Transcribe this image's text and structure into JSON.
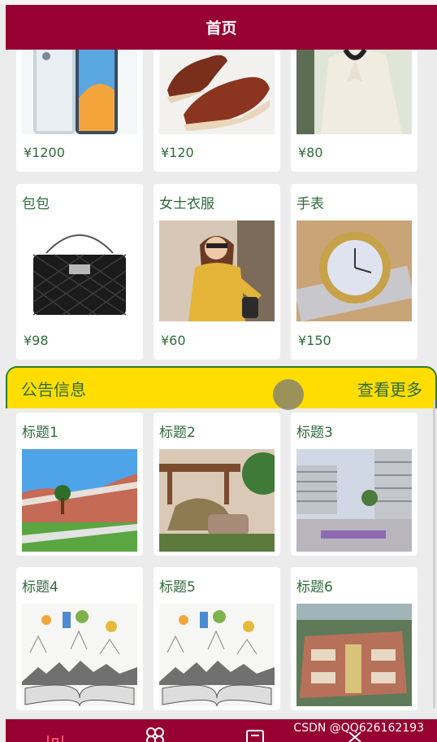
{
  "header": {
    "title": "首页"
  },
  "products_top": [
    {
      "price": "¥1200",
      "image_icon": "phone-image"
    },
    {
      "price": "¥120",
      "image_icon": "shoes-image"
    },
    {
      "price": "¥80",
      "image_icon": "blouse-image"
    }
  ],
  "products": [
    {
      "name": "包包",
      "price": "¥98",
      "image_icon": "handbag-image"
    },
    {
      "name": "女士衣服",
      "price": "¥60",
      "image_icon": "womens-clothing-image"
    },
    {
      "name": "手表",
      "price": "¥150",
      "image_icon": "watch-image"
    }
  ],
  "notice": {
    "title": "公告信息",
    "more": "查看更多"
  },
  "notices": [
    {
      "title": "标题1",
      "image_icon": "campus-garden-image"
    },
    {
      "title": "标题2",
      "image_icon": "sculpture-image"
    },
    {
      "title": "标题3",
      "image_icon": "campus-plaza-image"
    },
    {
      "title": "标题4",
      "image_icon": "book-city-image"
    },
    {
      "title": "标题5",
      "image_icon": "book-city-image"
    },
    {
      "title": "标题6",
      "image_icon": "aerial-campus-image"
    }
  ],
  "watermark": "CSDN @QQ626162193",
  "colors": {
    "header": "#960032",
    "notice_bar": "#ffdd00",
    "text_green": "#2f6b3a",
    "notice_border": "#2e7d32"
  }
}
